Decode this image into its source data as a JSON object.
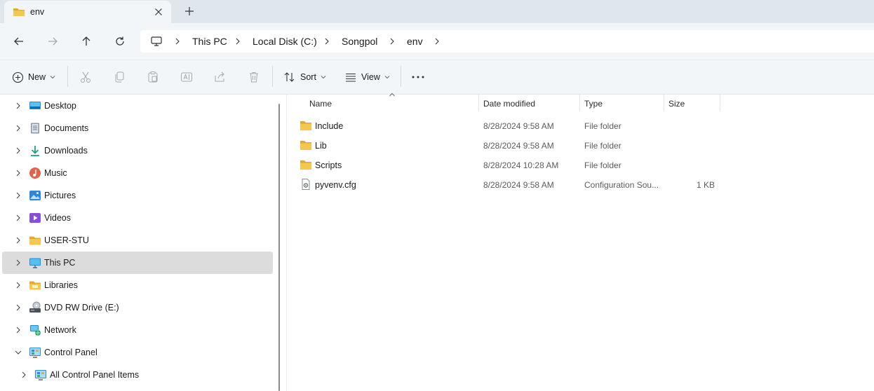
{
  "tab": {
    "title": "env",
    "close_icon": "close-icon",
    "new_tab_icon": "plus-icon"
  },
  "nav": {
    "back": "back-arrow-icon",
    "forward": "forward-arrow-icon",
    "up": "up-arrow-icon",
    "refresh": "refresh-icon"
  },
  "breadcrumb": {
    "root_icon": "computer-icon",
    "items": [
      "This PC",
      "Local Disk (C:)",
      "Songpol",
      "env"
    ]
  },
  "toolbar": {
    "new_label": "New",
    "sort_label": "Sort",
    "view_label": "View",
    "icons": [
      "cut-icon",
      "copy-icon",
      "paste-icon",
      "rename-icon",
      "share-icon",
      "delete-icon",
      "more-icon"
    ]
  },
  "sidebar": {
    "items": [
      {
        "label": "Desktop",
        "icon": "desktop-icon",
        "expanded": false
      },
      {
        "label": "Documents",
        "icon": "documents-icon",
        "expanded": false
      },
      {
        "label": "Downloads",
        "icon": "downloads-icon",
        "expanded": false
      },
      {
        "label": "Music",
        "icon": "music-icon",
        "expanded": false
      },
      {
        "label": "Pictures",
        "icon": "pictures-icon",
        "expanded": false
      },
      {
        "label": "Videos",
        "icon": "videos-icon",
        "expanded": false
      },
      {
        "label": "USER-STU",
        "icon": "folder-icon",
        "expanded": false
      },
      {
        "label": "This PC",
        "icon": "computer-icon",
        "expanded": false,
        "selected": true
      },
      {
        "label": "Libraries",
        "icon": "libraries-icon",
        "expanded": false
      },
      {
        "label": "DVD RW Drive (E:)",
        "icon": "dvd-drive-icon",
        "expanded": false
      },
      {
        "label": "Network",
        "icon": "network-icon",
        "expanded": false
      },
      {
        "label": "Control Panel",
        "icon": "control-panel-icon",
        "expanded": true
      },
      {
        "label": "All Control Panel Items",
        "icon": "control-panel-icon",
        "expanded": false
      }
    ]
  },
  "columns": {
    "name": "Name",
    "date": "Date modified",
    "type": "Type",
    "size": "Size"
  },
  "files": [
    {
      "name": "Include",
      "date": "8/28/2024 9:58 AM",
      "type": "File folder",
      "size": "",
      "icon": "folder-icon"
    },
    {
      "name": "Lib",
      "date": "8/28/2024 9:58 AM",
      "type": "File folder",
      "size": "",
      "icon": "folder-icon"
    },
    {
      "name": "Scripts",
      "date": "8/28/2024 10:28 AM",
      "type": "File folder",
      "size": "",
      "icon": "folder-icon"
    },
    {
      "name": "pyvenv.cfg",
      "date": "8/28/2024 9:58 AM",
      "type": "Configuration Sou...",
      "size": "1 KB",
      "icon": "config-file-icon"
    }
  ],
  "colors": {
    "folder": "#f4c74f",
    "folder_dark": "#e3a92c",
    "selected": "#dcdcdc",
    "accent": "#0067c0"
  }
}
